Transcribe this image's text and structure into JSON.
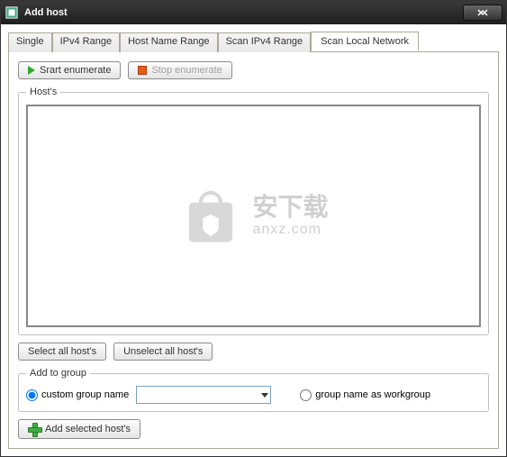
{
  "window": {
    "title": "Add host"
  },
  "tabs": {
    "single": "Single",
    "ipv4": "IPv4 Range",
    "hostname": "Host Name Range",
    "scanipv4": "Scan IPv4 Range",
    "scanlocal": "Scan Local Network"
  },
  "buttons": {
    "start": "Srart enumerate",
    "stop": "Stop enumerate",
    "selectAll": "Select all host's",
    "unselectAll": "Unselect all host's",
    "addSelected": "Add selected host's"
  },
  "groups": {
    "hosts": "Host's",
    "addTo": "Add to group"
  },
  "radios": {
    "custom": "custom group name",
    "workgroup": "group name as workgroup"
  },
  "combo": {
    "value": ""
  },
  "watermark": {
    "main": "安下载",
    "sub": "anxz.com"
  }
}
